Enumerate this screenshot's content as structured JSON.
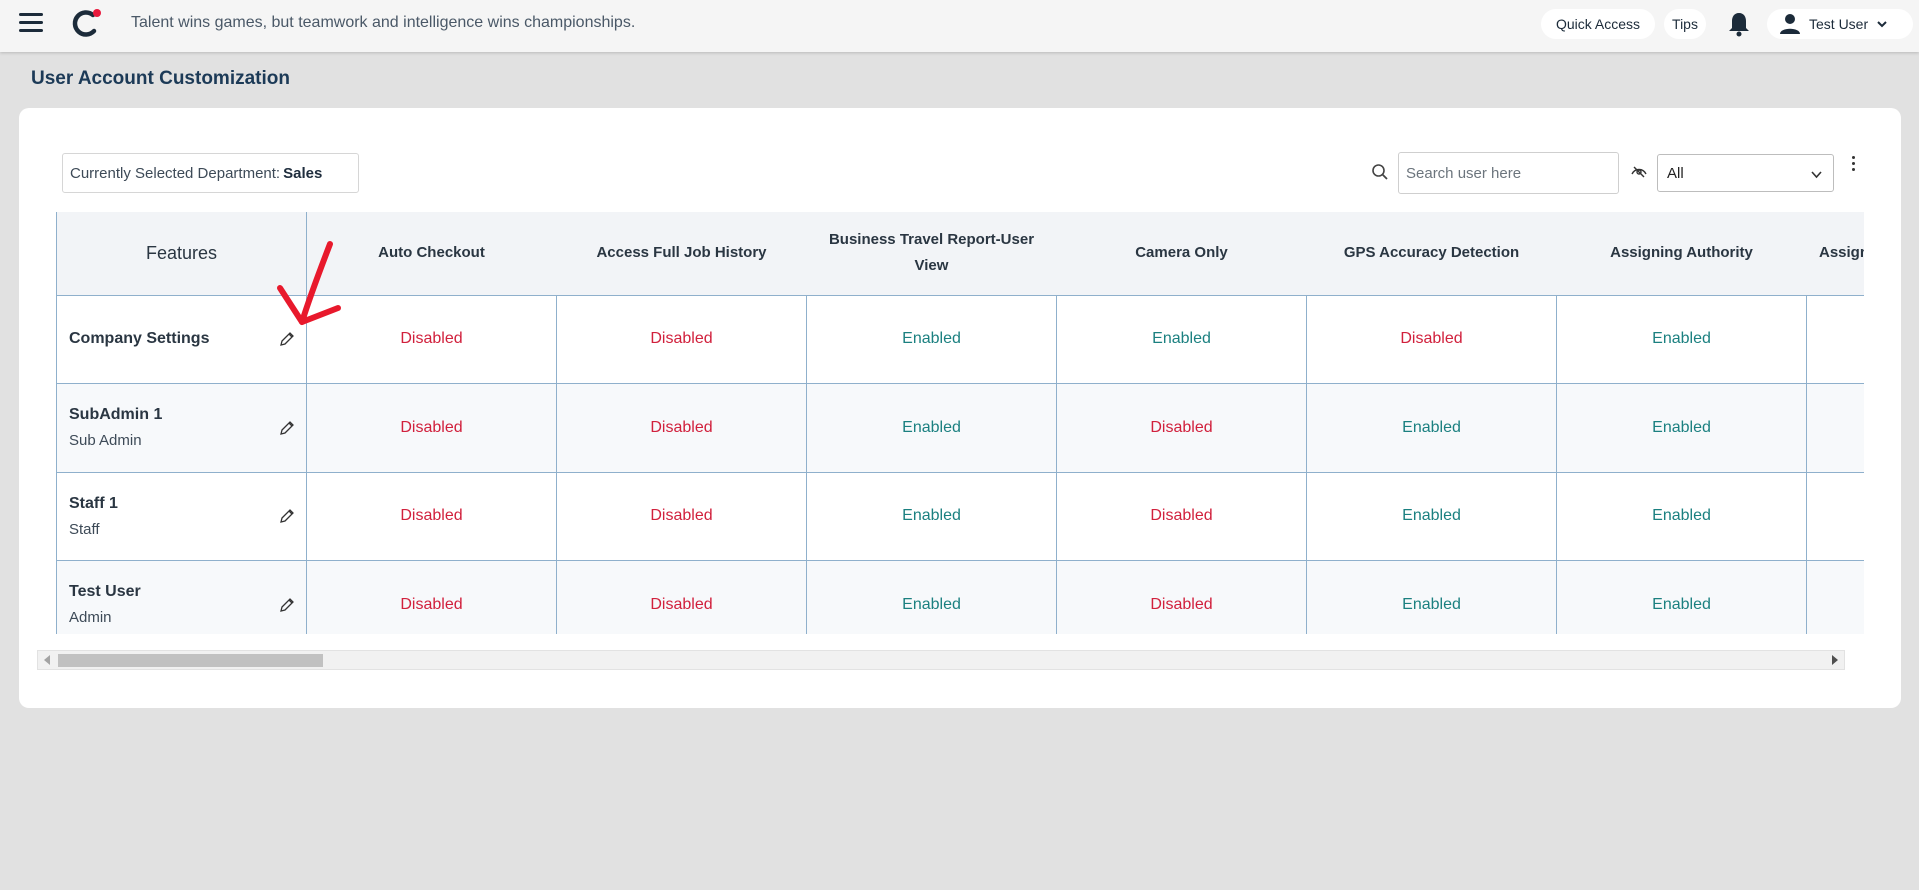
{
  "topbar": {
    "tagline": "Talent wins games, but teamwork and intelligence wins championships.",
    "quick_access": "Quick Access",
    "tips": "Tips",
    "user_name": "Test User"
  },
  "page": {
    "title": "User Account Customization"
  },
  "toolbar": {
    "department_label": "Currently Selected Department:",
    "department_value": "Sales",
    "search_placeholder": "Search user here",
    "filter_value": "All"
  },
  "table": {
    "features_header": "Features",
    "columns": [
      "Auto Checkout",
      "Access Full Job History",
      "Business Travel Report-User View",
      "Camera Only",
      "GPS Accuracy Detection",
      "Assigning Authority",
      "Assign"
    ],
    "rows": [
      {
        "name": "Company Settings",
        "role": "",
        "values": [
          "Disabled",
          "Disabled",
          "Enabled",
          "Enabled",
          "Disabled",
          "Enabled",
          ""
        ]
      },
      {
        "name": "SubAdmin 1",
        "role": "Sub Admin",
        "values": [
          "Disabled",
          "Disabled",
          "Enabled",
          "Disabled",
          "Enabled",
          "Enabled",
          ""
        ]
      },
      {
        "name": "Staff 1",
        "role": "Staff",
        "values": [
          "Disabled",
          "Disabled",
          "Enabled",
          "Disabled",
          "Enabled",
          "Enabled",
          ""
        ]
      },
      {
        "name": "Test User",
        "role": "Admin",
        "values": [
          "Disabled",
          "Disabled",
          "Enabled",
          "Disabled",
          "Enabled",
          "Enabled",
          ""
        ]
      }
    ]
  },
  "colors": {
    "enabled": "#1b8080",
    "disabled": "#d1203c",
    "title": "#1c3a57",
    "logo_dot": "#e8193c",
    "annotation": "#e8192c"
  },
  "icons": [
    "menu-icon",
    "logo-icon",
    "bell-icon",
    "user-icon",
    "chevron-down-icon",
    "search-icon",
    "filter-icon",
    "kebab-menu-icon",
    "pencil-edit-icon",
    "annotation-arrow"
  ]
}
